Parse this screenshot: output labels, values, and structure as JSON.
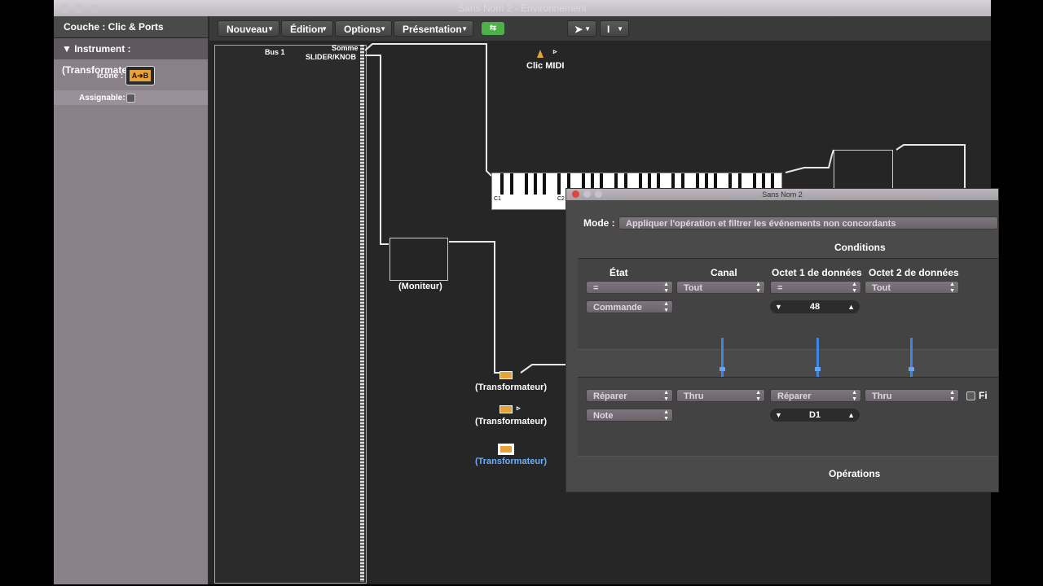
{
  "window": {
    "title": "Sans Nom 2 - Environnement"
  },
  "inspector": {
    "layer": "Couche : Clic & Ports",
    "instrument": "▼ Instrument : (Transformateur)",
    "icon_label": "Icône :",
    "icon_text": "A➔B",
    "assignable_label": "Assignable:"
  },
  "toolbar": {
    "menus": [
      "Nouveau",
      "Édition",
      "Options",
      "Présentation"
    ],
    "link_btn": "⇆"
  },
  "canvas": {
    "bus": "Bus 1",
    "somme": "Somme",
    "slider": "SLIDER/KNOB",
    "clic_midi": "Clic MIDI",
    "moniteur": "(Moniteur)",
    "transformers": [
      "(Transformateur)",
      "(Transformateur)",
      "(Transformateur)"
    ],
    "piano_c1": "C1",
    "piano_c2": "C2"
  },
  "dialog": {
    "title": "Sans Nom 2",
    "mode_label": "Mode :",
    "mode_value": "Appliquer l'opération et filtrer les événements non concordants",
    "conditions_label": "Conditions",
    "operations_label": "Opérations",
    "columns": [
      "État",
      "Canal",
      "Octet 1 de données",
      "Octet 2 de données"
    ],
    "conditions": {
      "etat": "=",
      "canal": "Tout",
      "octet1": "=",
      "octet2": "Tout",
      "type": "Commande",
      "octet1_value": "48"
    },
    "operations": {
      "etat": "Réparer",
      "canal": "Thru",
      "octet1": "Réparer",
      "octet2": "Thru",
      "type": "Note",
      "octet1_value": "D1",
      "filter_label": "Fi"
    }
  },
  "colors": {
    "accent": "#e8a23a",
    "selection": "#6aaeff",
    "slider": "#3e86e0",
    "close": "#e0443c",
    "link_button": "#4fb04a"
  }
}
